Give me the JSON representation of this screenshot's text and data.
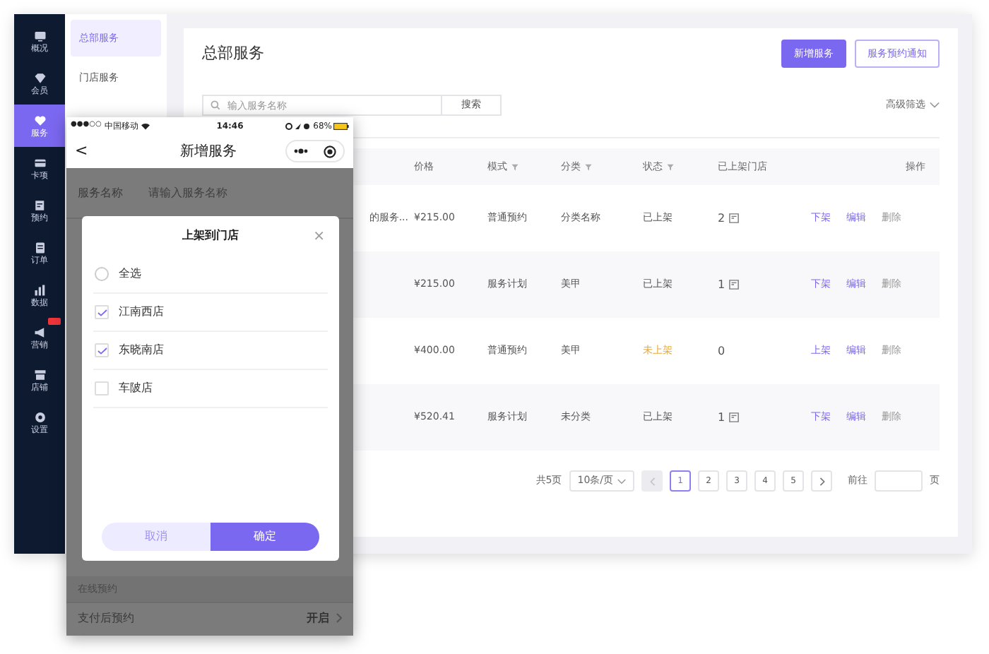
{
  "sidebar": {
    "items": [
      {
        "label": "概况",
        "selected": false,
        "badge": false
      },
      {
        "label": "会员",
        "selected": false,
        "badge": false
      },
      {
        "label": "服务",
        "selected": true,
        "badge": false
      },
      {
        "label": "卡项",
        "selected": false,
        "badge": false
      },
      {
        "label": "预约",
        "selected": false,
        "badge": false
      },
      {
        "label": "订单",
        "selected": false,
        "badge": false
      },
      {
        "label": "数据",
        "selected": false,
        "badge": false
      },
      {
        "label": "营销",
        "selected": false,
        "badge": true
      },
      {
        "label": "店铺",
        "selected": false,
        "badge": false
      },
      {
        "label": "设置",
        "selected": false,
        "badge": false
      }
    ]
  },
  "subnav": {
    "items": [
      {
        "label": "总部服务",
        "selected": true
      },
      {
        "label": "门店服务",
        "selected": false
      }
    ]
  },
  "main": {
    "title": "总部服务",
    "buttons": [
      {
        "label": "新增服务",
        "kind": "primary"
      },
      {
        "label": "服务预约通知",
        "kind": "outline"
      }
    ],
    "search": {
      "placeholder": "输入服务名称",
      "button": "搜索"
    },
    "advanced_filter": "高级筛选",
    "table": {
      "columns": [
        {
          "label": "价格",
          "filter": false
        },
        {
          "label": "模式",
          "filter": true
        },
        {
          "label": "分类",
          "filter": true
        },
        {
          "label": "状态",
          "filter": true
        },
        {
          "label": "已上架门店",
          "filter": false
        },
        {
          "label": "操作",
          "filter": false
        }
      ],
      "rows": [
        {
          "column_1": "的服务...",
          "price": "¥215.00",
          "mode": "普通预约",
          "category": "分类名称",
          "status": "已上架",
          "listed": true,
          "stores": "2",
          "store_icon": true,
          "actions": [
            {
              "label": "下架",
              "kind": "link"
            },
            {
              "label": "编辑",
              "kind": "link"
            },
            {
              "label": "删除",
              "kind": "muted"
            }
          ]
        },
        {
          "price": "¥215.00",
          "mode": "服务计划",
          "category": "美甲",
          "status": "已上架",
          "listed": true,
          "stores": "1",
          "store_icon": true,
          "actions": [
            {
              "label": "下架",
              "kind": "link"
            },
            {
              "label": "编辑",
              "kind": "link"
            },
            {
              "label": "删除",
              "kind": "muted"
            }
          ]
        },
        {
          "price": "¥400.00",
          "mode": "普通预约",
          "category": "美甲",
          "status": "未上架",
          "listed": false,
          "stores": "0",
          "store_icon": false,
          "actions": [
            {
              "label": "上架",
              "kind": "link"
            },
            {
              "label": "编辑",
              "kind": "link"
            },
            {
              "label": "删除",
              "kind": "muted"
            }
          ]
        },
        {
          "price": "¥520.41",
          "mode": "服务计划",
          "category": "未分类",
          "status": "已上架",
          "listed": true,
          "stores": "1",
          "store_icon": true,
          "actions": [
            {
              "label": "下架",
              "kind": "link"
            },
            {
              "label": "编辑",
              "kind": "link"
            },
            {
              "label": "删除",
              "kind": "muted"
            }
          ]
        }
      ]
    },
    "pagination": {
      "total": "共5页",
      "page_size": "10条/页",
      "prev_disabled": true,
      "pages": [
        {
          "label": "1",
          "selected": true
        },
        {
          "label": "2",
          "selected": false
        },
        {
          "label": "3",
          "selected": false
        },
        {
          "label": "4",
          "selected": false
        },
        {
          "label": "5",
          "selected": false
        }
      ],
      "next_disabled": false,
      "goto_label": "前往",
      "goto_suffix": "页"
    }
  },
  "phone": {
    "status_bar": {
      "signal": "●●●○○",
      "carrier": "中国移动",
      "time": "14:46",
      "battery": "68%"
    },
    "nav": {
      "back": "<",
      "title": "新增服务"
    },
    "form": {
      "name_label": "服务名称",
      "name_placeholder": "请输入服务名称",
      "section": "在线预约",
      "row_label": "支付后预约",
      "row_value": "开启"
    },
    "modal": {
      "title": "上架到门店",
      "close": "×",
      "options": [
        {
          "label": "全选",
          "kind": "radio",
          "checked": false
        },
        {
          "label": "江南西店",
          "kind": "checkbox",
          "checked": true
        },
        {
          "label": "东晓南店",
          "kind": "checkbox",
          "checked": true
        },
        {
          "label": "车陂店",
          "kind": "checkbox",
          "checked": false
        }
      ],
      "cancel": "取消",
      "confirm": "确定"
    }
  }
}
